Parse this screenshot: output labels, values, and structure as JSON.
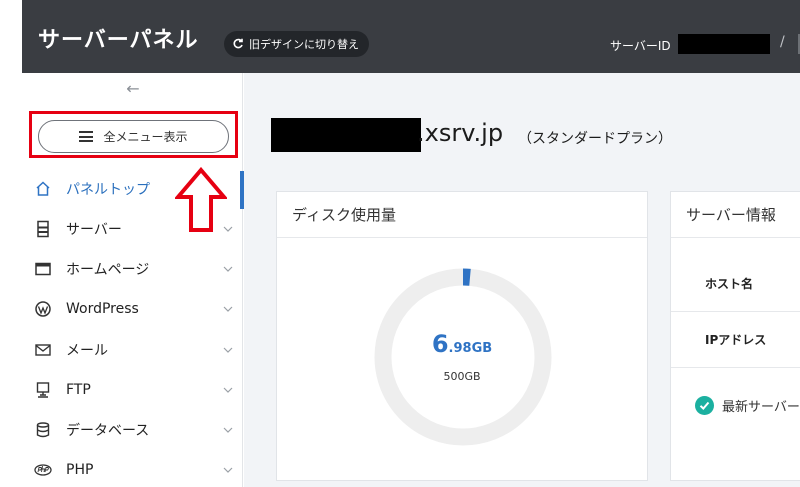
{
  "header": {
    "title": "サーバーパネル",
    "switch_label": "旧デザインに切り替え",
    "server_id_label": "サーバーID",
    "server_id_value": "",
    "separator": "/"
  },
  "sidebar": {
    "collapse_glyph": "←",
    "all_menu_label": "全メニュー表示",
    "items": [
      {
        "label": "パネルトップ",
        "icon": "home-icon",
        "active": true
      },
      {
        "label": "サーバー",
        "icon": "server-icon"
      },
      {
        "label": "ホームページ",
        "icon": "window-icon"
      },
      {
        "label": "WordPress",
        "icon": "wordpress-icon"
      },
      {
        "label": "メール",
        "icon": "mail-icon"
      },
      {
        "label": "FTP",
        "icon": "ftp-icon"
      },
      {
        "label": "データベース",
        "icon": "database-icon"
      },
      {
        "label": "PHP",
        "icon": "php-icon"
      }
    ]
  },
  "main": {
    "domain_suffix": ".xsrv.jp",
    "plan": "（スタンダードプラン）",
    "disk": {
      "title": "ディスク使用量",
      "used_whole": "6",
      "used_fraction": ".98GB",
      "total": "500GB",
      "used_gb": 6.98,
      "total_gb": 500
    },
    "server_info": {
      "title": "サーバー情報",
      "rows": [
        "ホスト名",
        "IPアドレス"
      ],
      "latest": "最新サーバー"
    }
  },
  "colors": {
    "header_bg": "#3a3d42",
    "accent": "#2f73c4",
    "highlight": "#e60012",
    "check": "#1bb0a0"
  }
}
